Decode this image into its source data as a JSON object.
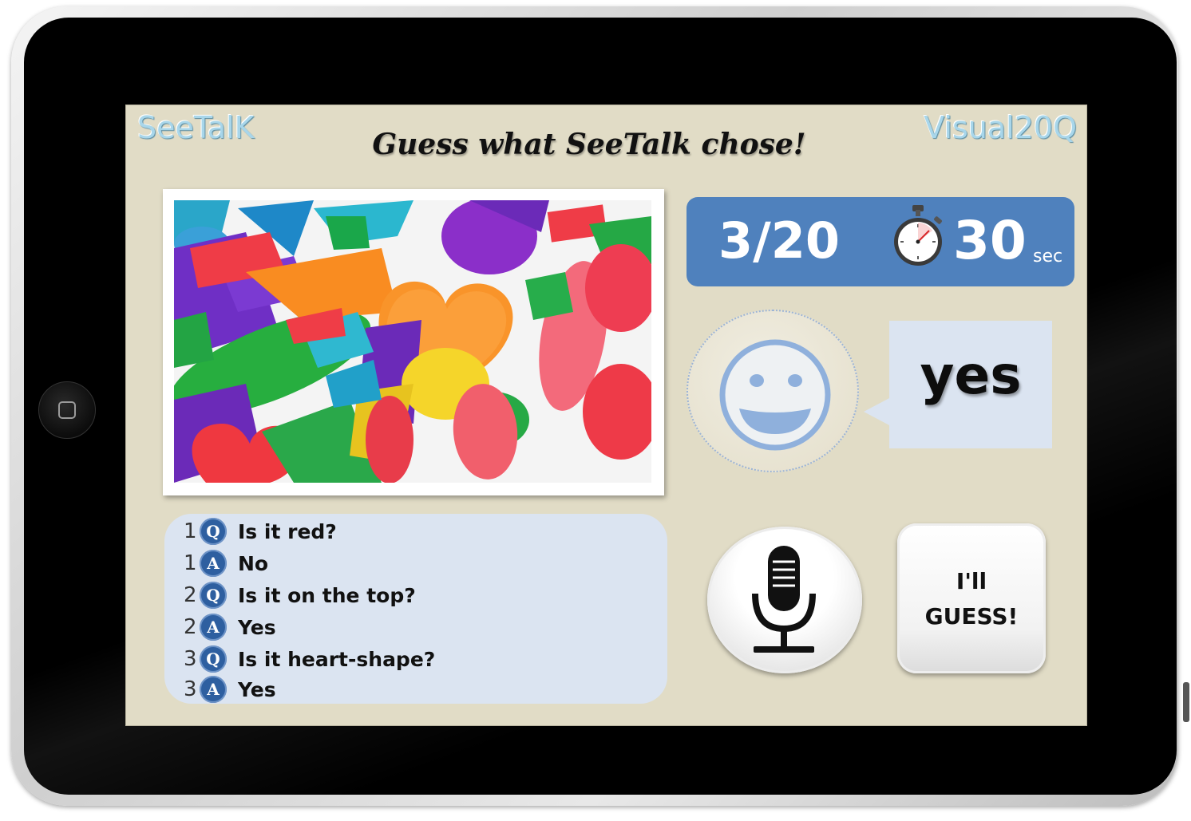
{
  "app": {
    "brand_left": "SeeTalK",
    "brand_right": "Visual20Q",
    "title": "Guess what SeeTalk chose!"
  },
  "status": {
    "question_count": "3/20",
    "timer_value": "30",
    "timer_unit": "sec"
  },
  "answer": {
    "text": "yes"
  },
  "history": [
    {
      "num": "1",
      "type": "Q",
      "text": "Is it red?"
    },
    {
      "num": "1",
      "type": "A",
      "text": "No"
    },
    {
      "num": "2",
      "type": "Q",
      "text": "Is it on the top?"
    },
    {
      "num": "2",
      "type": "A",
      "text": "Yes"
    },
    {
      "num": "3",
      "type": "Q",
      "text": "Is it heart-shape?"
    },
    {
      "num": "3",
      "type": "A",
      "text": "Yes"
    }
  ],
  "buttons": {
    "guess_line1": "I'll",
    "guess_line2": "GUESS!"
  },
  "icons": [
    "stopwatch-icon",
    "smiley-face-icon",
    "microphone-icon",
    "home-button-icon"
  ],
  "colors": {
    "screen_bg": "#e1dcc6",
    "accent_blue": "#4f81bd",
    "panel_light_blue": "#dbe4f1",
    "brand_text": "#a8d6ea",
    "badge_blue": "#2e5fa0"
  }
}
